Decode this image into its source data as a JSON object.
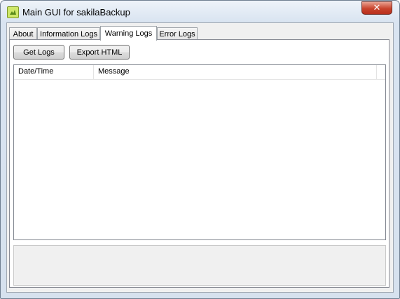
{
  "window": {
    "title": "Main GUI for sakilaBackup",
    "close_glyph": "✕",
    "icon": "app-icon"
  },
  "tabs": [
    {
      "label": "About"
    },
    {
      "label": "Information Logs"
    },
    {
      "label": "Warning Logs",
      "active": true
    },
    {
      "label": "Error Logs"
    }
  ],
  "toolbar": {
    "get_logs_label": "Get Logs",
    "export_html_label": "Export HTML"
  },
  "log_table": {
    "columns": [
      "Date/Time",
      "Message"
    ],
    "rows": []
  },
  "colors": {
    "close_button": "#c9432c",
    "frame": "#d9e4f1"
  }
}
